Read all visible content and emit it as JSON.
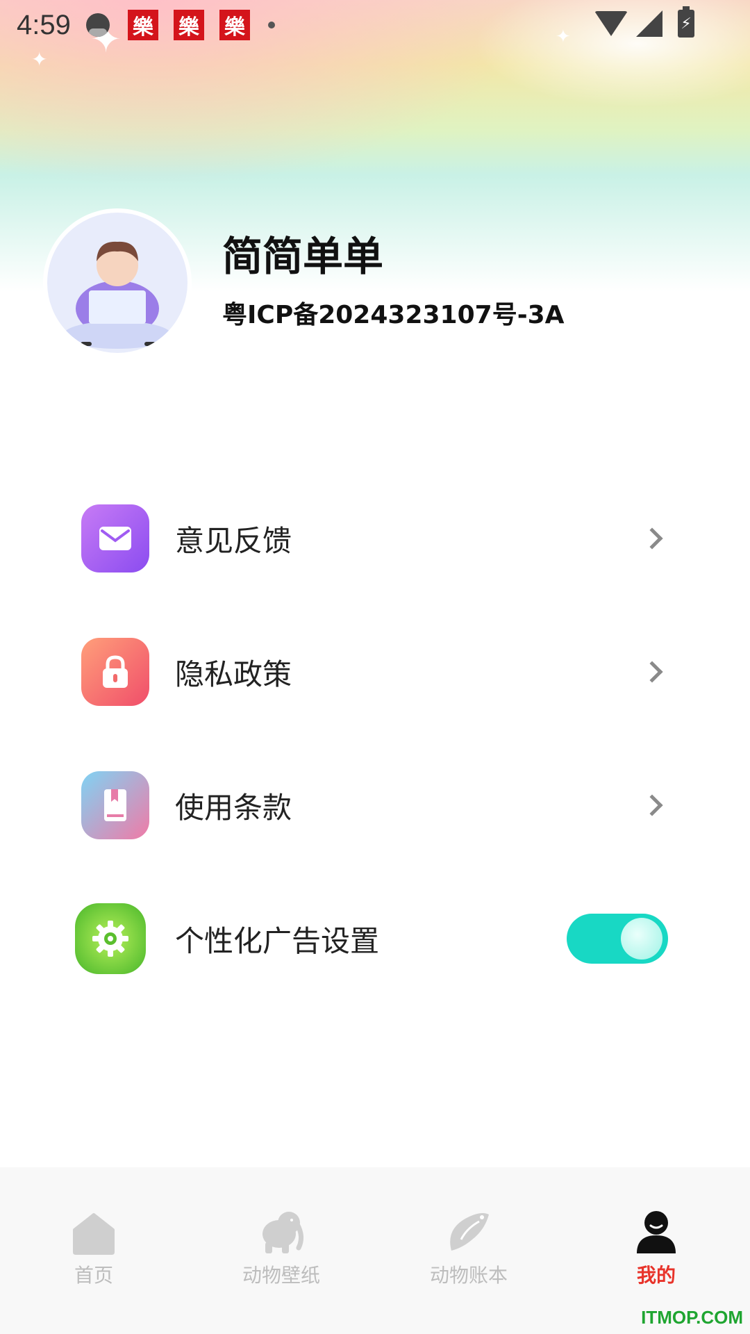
{
  "status_bar": {
    "time": "4:59",
    "app_icon_glyph": "樂"
  },
  "profile": {
    "name": "简简单单",
    "icp": "粤ICP备2024323107号-3A"
  },
  "menu": {
    "items": [
      {
        "label": "意见反馈",
        "icon": "mail-icon"
      },
      {
        "label": "隐私政策",
        "icon": "lock-icon"
      },
      {
        "label": "使用条款",
        "icon": "book-icon"
      },
      {
        "label": "个性化广告设置",
        "icon": "gear-icon",
        "toggle_on": true
      }
    ]
  },
  "tabbar": {
    "tabs": [
      {
        "label": "首页",
        "icon": "home-icon",
        "active": false
      },
      {
        "label": "动物壁纸",
        "icon": "elephant-icon",
        "active": false
      },
      {
        "label": "动物账本",
        "icon": "animal-icon",
        "active": false
      },
      {
        "label": "我的",
        "icon": "person-icon",
        "active": true
      }
    ]
  },
  "watermark": "ITMOP.COM",
  "colors": {
    "accent_red": "#e8332a",
    "toggle_on": "#18d8c4",
    "text_dark": "#111111",
    "tab_inactive": "#bdbdbd"
  }
}
